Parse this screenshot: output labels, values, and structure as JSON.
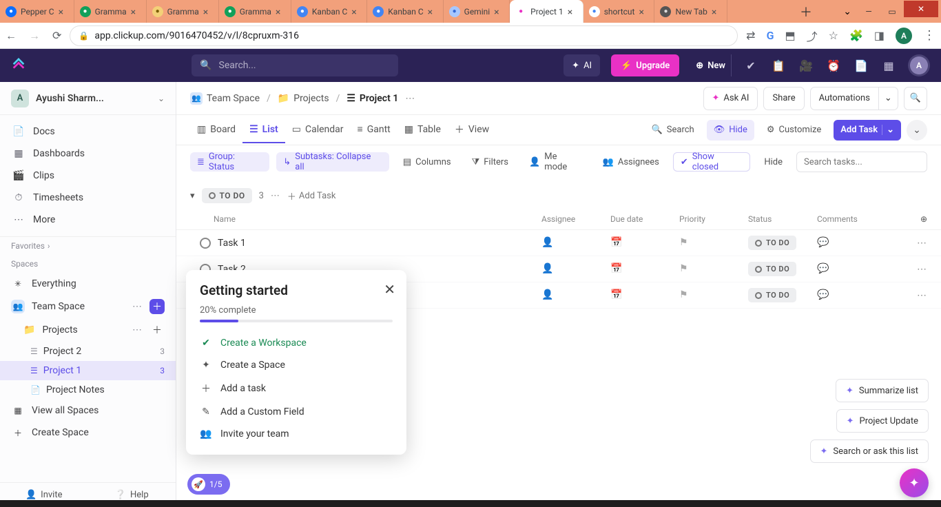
{
  "browser": {
    "tabs": [
      {
        "title": "Pepper C",
        "fav_bg": "#0d6efd",
        "fav_color": "#fff"
      },
      {
        "title": "Gramma",
        "fav_bg": "#11a05a",
        "fav_color": "#fff"
      },
      {
        "title": "Gramma",
        "fav_bg": "#f3d078",
        "fav_color": "#7a5c00"
      },
      {
        "title": "Gramma",
        "fav_bg": "#11a05a",
        "fav_color": "#fff"
      },
      {
        "title": "Kanban C",
        "fav_bg": "#4285f4",
        "fav_color": "#fff"
      },
      {
        "title": "Kanban C",
        "fav_bg": "#4285f4",
        "fav_color": "#fff"
      },
      {
        "title": "Gemini",
        "fav_bg": "#a7c7ff",
        "fav_color": "#3367d6"
      },
      {
        "title": "Project 1",
        "fav_bg": "#fff",
        "fav_color": "#e931c5",
        "active": true
      },
      {
        "title": "shortcut",
        "fav_bg": "#fff",
        "fav_color": "#4285f4"
      },
      {
        "title": "New Tab",
        "fav_bg": "#555",
        "fav_color": "#ddd"
      }
    ],
    "url": "app.clickup.com/9016470452/v/l/8cpruxm-316",
    "avatar_letter": "A"
  },
  "topbar": {
    "search_placeholder": "Search...",
    "ai_label": "AI",
    "upgrade_label": "Upgrade",
    "new_label": "New",
    "avatar_letter": "A"
  },
  "workspace": {
    "avatar_letter": "A",
    "name": "Ayushi Sharm..."
  },
  "sidebar": {
    "nav": [
      {
        "icon": "📄",
        "label": "Docs"
      },
      {
        "icon": "▦",
        "label": "Dashboards"
      },
      {
        "icon": "🎬",
        "label": "Clips"
      },
      {
        "icon": "⏱",
        "label": "Timesheets"
      },
      {
        "icon": "⋯",
        "label": "More"
      }
    ],
    "favorites_label": "Favorites",
    "spaces_label": "Spaces",
    "everything_label": "Everything",
    "team_space_label": "Team Space",
    "projects_label": "Projects",
    "projects_children": [
      {
        "label": "Project 2",
        "count": "3"
      },
      {
        "label": "Project 1",
        "count": "3",
        "selected": true
      },
      {
        "label": "Project Notes"
      }
    ],
    "view_all_label": "View all Spaces",
    "create_space_label": "Create Space",
    "invite_label": "Invite",
    "help_label": "Help"
  },
  "breadcrumbs": {
    "items": [
      "Team Space",
      "Projects",
      "Project 1"
    ],
    "ask_ai": "Ask AI",
    "share": "Share",
    "automations": "Automations"
  },
  "views": {
    "tabs": [
      {
        "icon": "▥",
        "label": "Board"
      },
      {
        "icon": "☰",
        "label": "List",
        "active": true
      },
      {
        "icon": "▭",
        "label": "Calendar"
      },
      {
        "icon": "≡",
        "label": "Gantt"
      },
      {
        "icon": "▦",
        "label": "Table"
      },
      {
        "icon": "＋",
        "label": "View"
      }
    ],
    "search": "Search",
    "hide": "Hide",
    "customize": "Customize",
    "add_task": "Add Task"
  },
  "filters": {
    "group": "Group: Status",
    "subtasks": "Subtasks: Collapse all",
    "columns": "Columns",
    "filters": "Filters",
    "me_mode": "Me mode",
    "assignees": "Assignees",
    "show_closed": "Show closed",
    "hide": "Hide",
    "search_placeholder": "Search tasks..."
  },
  "group": {
    "status": "TO DO",
    "count": "3",
    "add_task": "Add Task"
  },
  "columns": {
    "name": "Name",
    "assignee": "Assignee",
    "due": "Due date",
    "priority": "Priority",
    "status": "Status",
    "comments": "Comments"
  },
  "tasks": [
    {
      "name": "Task 1",
      "status": "TO DO"
    },
    {
      "name": "Task 2",
      "status": "TO DO"
    },
    {
      "name": "",
      "status": "TO DO"
    }
  ],
  "getting_started": {
    "title": "Getting started",
    "pct_label": "20% complete",
    "items": [
      {
        "label": "Create a Workspace",
        "done": true,
        "icon": "✔"
      },
      {
        "label": "Create a Space",
        "icon": "✦"
      },
      {
        "label": "Add a task",
        "icon": "＋"
      },
      {
        "label": "Add a Custom Field",
        "icon": "✎"
      },
      {
        "label": "Invite your team",
        "icon": "👥"
      }
    ]
  },
  "progress_bubble": "1/5",
  "float_buttons": {
    "summarize": "Summarize list",
    "project_update": "Project Update",
    "search_or_ask": "Search or ask this list"
  }
}
